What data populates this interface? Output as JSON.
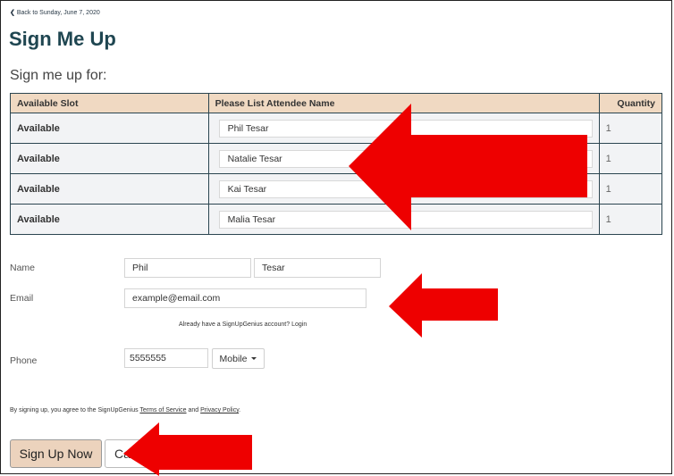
{
  "back_link": {
    "label": "Back to Sunday, June 7, 2020"
  },
  "page_title": "Sign Me Up",
  "subheading": "Sign me up for:",
  "slots_table": {
    "headers": {
      "slot": "Available Slot",
      "attendee": "Please List Attendee Name",
      "quantity": "Quantity"
    },
    "rows": [
      {
        "slot": "Available",
        "attendee": "Phil Tesar",
        "quantity": "1"
      },
      {
        "slot": "Available",
        "attendee": "Natalie Tesar",
        "quantity": "1"
      },
      {
        "slot": "Available",
        "attendee": "Kai Tesar",
        "quantity": "1"
      },
      {
        "slot": "Available",
        "attendee": "Malia Tesar",
        "quantity": "1"
      }
    ]
  },
  "form": {
    "name_label": "Name",
    "first_name": "Phil",
    "last_name": "Tesar",
    "email_label": "Email",
    "email": "example@email.com",
    "login_note": "Already have a SignUpGenius account? Login",
    "phone_label": "Phone",
    "phone": "5555555",
    "phone_type": "Mobile"
  },
  "terms": {
    "prefix": "By signing up, you agree to the SignUpGenius ",
    "tos": "Terms of Service",
    "and": " and ",
    "privacy": "Privacy Policy",
    "suffix": "."
  },
  "buttons": {
    "signup": "Sign Up Now",
    "cancel": "Cancel"
  },
  "colors": {
    "header_bg": "#f0d9c2",
    "title": "#1f4651",
    "arrow": "#ee0000"
  },
  "icons": {
    "back": "chevron-left-icon",
    "dropdown": "caret-down-icon"
  }
}
